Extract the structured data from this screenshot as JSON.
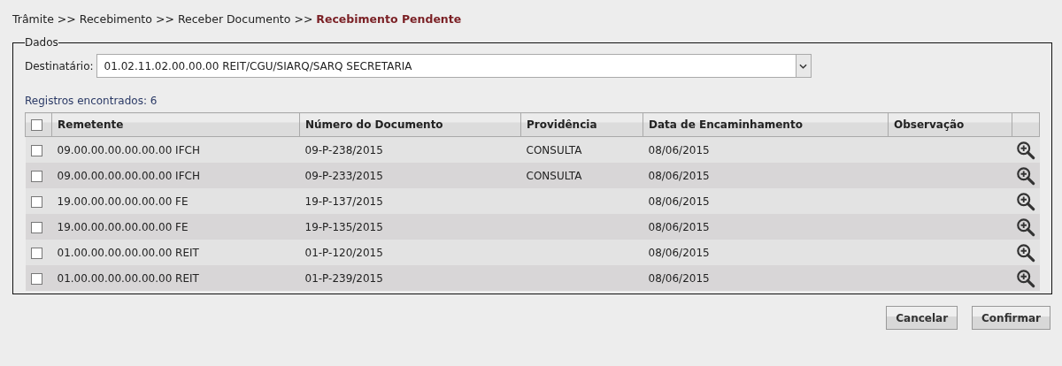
{
  "breadcrumb": [
    {
      "label": "Trâmite",
      "current": false
    },
    {
      "label": "Recebimento",
      "current": false
    },
    {
      "label": "Receber Documento",
      "current": false
    },
    {
      "label": "Recebimento Pendente",
      "current": true
    }
  ],
  "breadcrumb_separator": ">>",
  "fieldset": {
    "legend": "Dados"
  },
  "destinatario": {
    "label": "Destinatário:",
    "value": "01.02.11.02.00.00.00 REIT/CGU/SIARQ/SARQ SECRETARIA"
  },
  "records_found": "Registros encontrados: 6",
  "table": {
    "select_all_checked": false,
    "columns": [
      "Remetente",
      "Número do Documento",
      "Providência",
      "Data de Encaminhamento",
      "Observação"
    ],
    "rows": [
      {
        "checked": false,
        "cells": [
          "09.00.00.00.00.00.00 IFCH",
          "09-P-238/2015",
          "CONSULTA",
          "08/06/2015",
          ""
        ]
      },
      {
        "checked": false,
        "cells": [
          "09.00.00.00.00.00.00 IFCH",
          "09-P-233/2015",
          "CONSULTA",
          "08/06/2015",
          ""
        ]
      },
      {
        "checked": false,
        "cells": [
          "19.00.00.00.00.00.00 FE",
          "19-P-137/2015",
          "",
          "08/06/2015",
          ""
        ]
      },
      {
        "checked": false,
        "cells": [
          "19.00.00.00.00.00.00 FE",
          "19-P-135/2015",
          "",
          "08/06/2015",
          ""
        ]
      },
      {
        "checked": false,
        "cells": [
          "01.00.00.00.00.00.00 REIT",
          "01-P-120/2015",
          "",
          "08/06/2015",
          ""
        ]
      },
      {
        "checked": false,
        "cells": [
          "01.00.00.00.00.00.00 REIT",
          "01-P-239/2015",
          "",
          "08/06/2015",
          ""
        ]
      }
    ]
  },
  "buttons": [
    "Cancelar",
    "Confirmar"
  ]
}
